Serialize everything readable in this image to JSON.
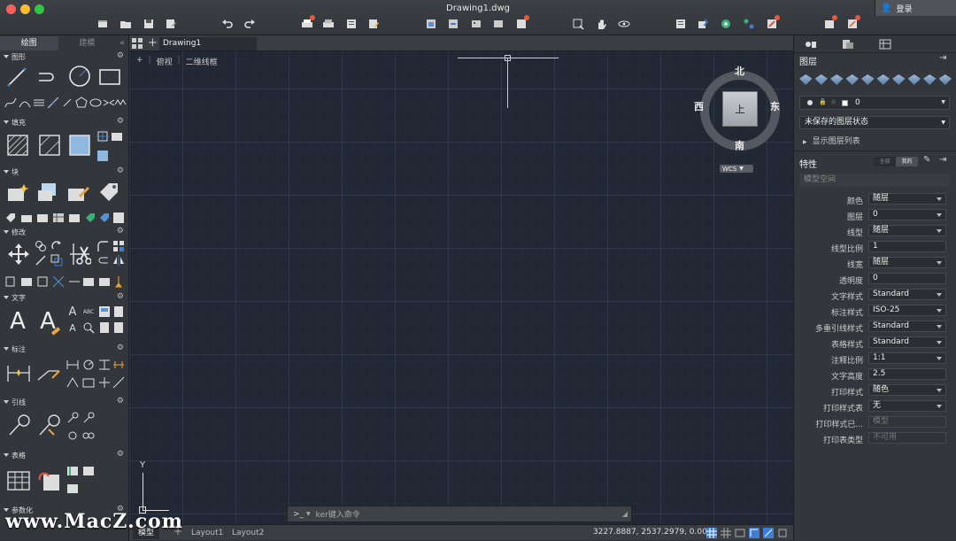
{
  "window": {
    "title": "Drawing1.dwg",
    "login": "登录"
  },
  "left_panel": {
    "tabs": [
      "绘图",
      "建模"
    ],
    "sections": [
      {
        "title": "图形",
        "icons": [
          "line-icon",
          "polyline-icon",
          "circle-icon",
          "rectangle-icon",
          "spline-icon",
          "arc-icon",
          "ellipse-icon",
          "polygon-icon",
          "revcloud-icon",
          "xline-icon"
        ]
      },
      {
        "title": "填充",
        "icons": [
          "hatch-icon",
          "gradient-icon",
          "boundary-icon",
          "region-icon"
        ]
      },
      {
        "title": "块",
        "icons": [
          "create-block-icon",
          "insert-block-icon",
          "edit-block-icon",
          "block-attribute-icon"
        ]
      },
      {
        "title": "修改",
        "icons": [
          "move-icon",
          "copy-icon",
          "rotate-icon",
          "trim-icon",
          "fillet-icon",
          "array-icon",
          "scale-icon",
          "mirror-icon",
          "offset-icon",
          "stretch-icon"
        ]
      },
      {
        "title": "文字",
        "icons": [
          "multiline-text-icon",
          "single-line-text-icon",
          "text-style-icon",
          "spell-check-icon",
          "find-text-icon"
        ]
      },
      {
        "title": "标注",
        "icons": [
          "dimension-icon",
          "leader-dim-icon",
          "linear-dim-icon",
          "radius-dim-icon"
        ]
      },
      {
        "title": "引线",
        "icons": [
          "multileader-icon",
          "add-leader-icon"
        ]
      },
      {
        "title": "表格",
        "icons": [
          "table-icon",
          "link-data-icon"
        ]
      },
      {
        "title": "参数化",
        "icons": []
      }
    ]
  },
  "canvas": {
    "file_tab": "Drawing1",
    "view_controls": {
      "plus": "+",
      "view": "俯视",
      "style": "二维线框"
    },
    "viewcube": {
      "north": "北",
      "south": "南",
      "east": "东",
      "west": "西",
      "top": "上",
      "wcs": "WCS"
    },
    "ucs": {
      "y": "Y"
    },
    "command_placeholder": "ker键入命令",
    "command_prompt": ">_"
  },
  "right_panel": {
    "layer_title": "图层",
    "layer_current": "0",
    "layer_state": "未保存的图层状态",
    "layer_list": "显示图层列表",
    "props_title": "特性",
    "props_toggle": [
      "全部",
      "我的"
    ],
    "space": "模型空间",
    "properties": [
      {
        "label": "颜色",
        "value": "随层",
        "dd": true
      },
      {
        "label": "图层",
        "value": "0",
        "dd": true
      },
      {
        "label": "线型",
        "value": "随层",
        "dd": true
      },
      {
        "label": "线型比例",
        "value": "1",
        "dd": false
      },
      {
        "label": "线宽",
        "value": "随层",
        "dd": true
      },
      {
        "label": "透明度",
        "value": "0",
        "dd": false
      },
      {
        "label": "文字样式",
        "value": "Standard",
        "dd": true
      },
      {
        "label": "标注样式",
        "value": "ISO-25",
        "dd": true
      },
      {
        "label": "多重引线样式",
        "value": "Standard",
        "dd": true
      },
      {
        "label": "表格样式",
        "value": "Standard",
        "dd": true
      },
      {
        "label": "注释比例",
        "value": "1:1",
        "dd": true
      },
      {
        "label": "文字高度",
        "value": "2.5",
        "dd": false
      },
      {
        "label": "打印样式",
        "value": "随色",
        "dd": true
      },
      {
        "label": "打印样式表",
        "value": "无",
        "dd": true
      },
      {
        "label": "打印样式已...",
        "value": "模型",
        "dd": false,
        "disabled": true
      },
      {
        "label": "打印表类型",
        "value": "不可用",
        "dd": false,
        "disabled": true
      }
    ]
  },
  "status": {
    "tabs": [
      "模型",
      "Layout1",
      "Layout2"
    ],
    "coords": "3227.8887, 2537.2979, 0.0000",
    "scale": "1:1"
  },
  "watermark": "www.MacZ.com",
  "colors": {
    "accent": "#3d7fd6",
    "canvas": "#212833",
    "red_dot": "#e85a3a"
  }
}
